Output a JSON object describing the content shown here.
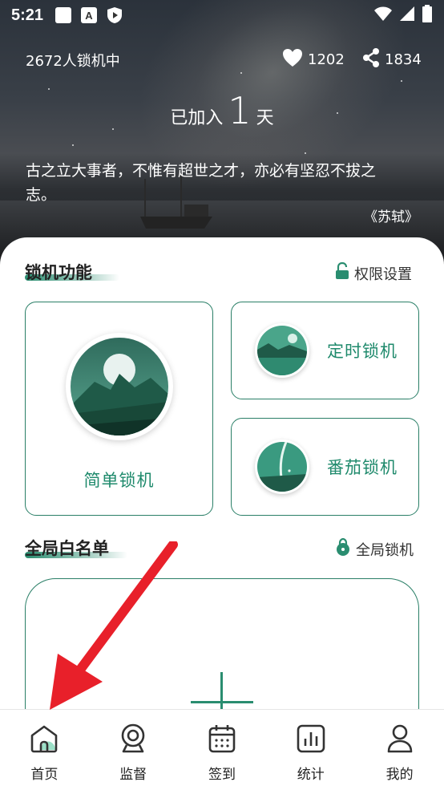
{
  "status_bar": {
    "time": "5:21",
    "icons": [
      "square-icon",
      "a-badge-icon",
      "shield-play-icon"
    ],
    "right_icons": [
      "wifi-icon",
      "signal-icon",
      "battery-icon"
    ]
  },
  "header": {
    "online_count_text": "2672人锁机中",
    "likes": "1202",
    "shares": "1834",
    "joined_prefix": "已加入",
    "joined_days": "1",
    "joined_suffix": "天",
    "quote": "古之立大事者，不惟有超世之才，亦必有坚忍不拔之志。",
    "author": "《苏轼》"
  },
  "lock_section": {
    "title": "锁机功能",
    "action_label": "权限设置",
    "cards": [
      {
        "label": "简单锁机"
      },
      {
        "label": "定时锁机"
      },
      {
        "label": "番茄锁机"
      }
    ]
  },
  "whitelist_section": {
    "title": "全局白名单",
    "action_label": "全局锁机"
  },
  "bottom_nav": {
    "items": [
      {
        "label": "首页",
        "icon": "home-icon"
      },
      {
        "label": "监督",
        "icon": "webcam-icon"
      },
      {
        "label": "签到",
        "icon": "calendar-icon"
      },
      {
        "label": "统计",
        "icon": "chart-icon"
      },
      {
        "label": "我的",
        "icon": "user-icon"
      }
    ]
  },
  "colors": {
    "accent": "#2a8d70",
    "card_border": "#2a7f67",
    "annotation_arrow": "#e8202a"
  }
}
